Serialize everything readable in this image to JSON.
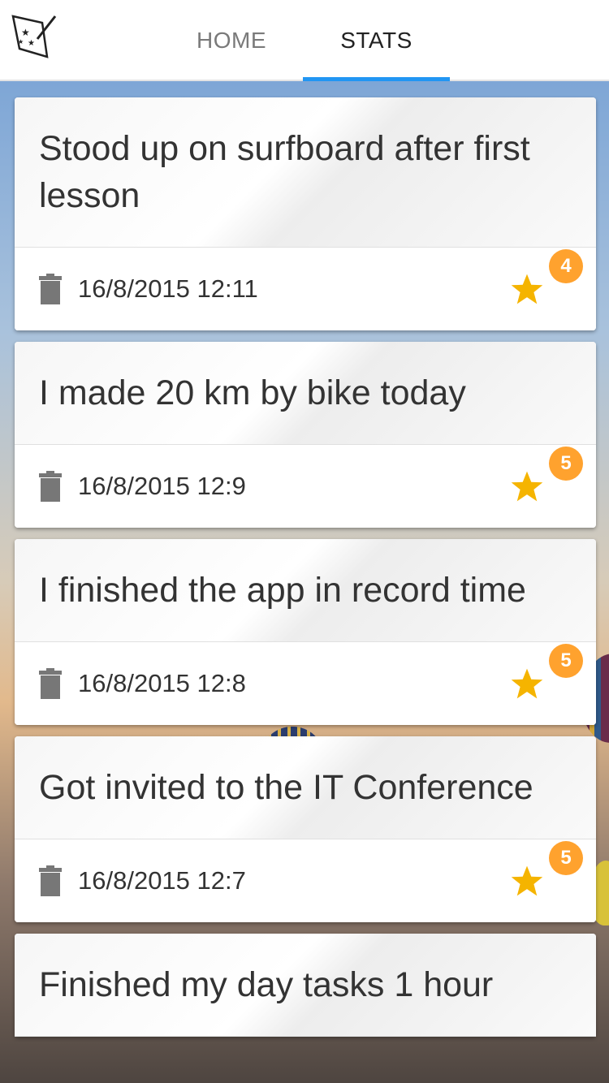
{
  "nav": {
    "tabs": [
      {
        "label": "HOME",
        "active": false
      },
      {
        "label": "STATS",
        "active": true
      }
    ],
    "accent_color": "#2196f3"
  },
  "achievements": [
    {
      "title": "Stood up on surfboard after first lesson",
      "date": "16/8/2015 12:11",
      "stars": "4"
    },
    {
      "title": "I made 20 km by bike today",
      "date": "16/8/2015 12:9",
      "stars": "5"
    },
    {
      "title": "I finished the app in record time",
      "date": "16/8/2015 12:8",
      "stars": "5"
    },
    {
      "title": "Got invited to the IT Conference",
      "date": "16/8/2015 12:7",
      "stars": "5"
    },
    {
      "title": "Finished my day tasks 1 hour",
      "date": "",
      "stars": ""
    }
  ],
  "colors": {
    "star": "#f5b400",
    "badge": "#ffa22e",
    "trash": "#777777"
  },
  "icons": [
    "app-logo-icon",
    "trash-icon",
    "star-icon"
  ]
}
